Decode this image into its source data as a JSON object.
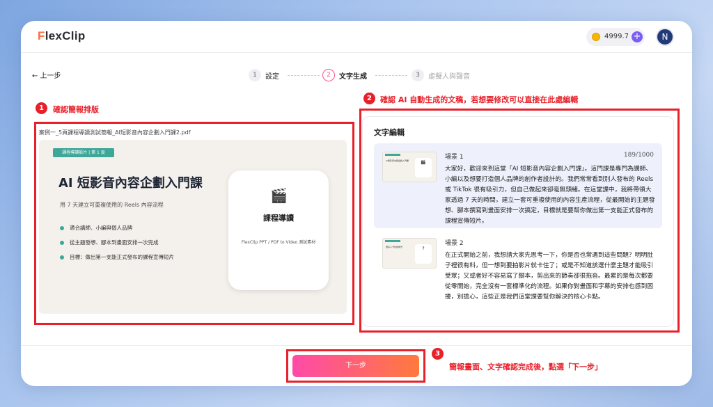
{
  "app": {
    "logo_prefix": "F",
    "logo_rest": "lexClip",
    "credits": "4999.7",
    "plus": "+",
    "avatar": "N"
  },
  "nav": {
    "back": "← 上一步"
  },
  "steps": [
    {
      "num": "1",
      "label": "設定"
    },
    {
      "num": "2",
      "label": "文字生成"
    },
    {
      "num": "3",
      "label": "虛擬人與聲音"
    }
  ],
  "annotations": {
    "a1": {
      "num": "1",
      "text": "確認簡報排版"
    },
    "a2": {
      "num": "2",
      "text": "確認 AI 自動生成的文稿，若想要修改可以直接在此處編輯"
    },
    "a3": {
      "num": "3",
      "text": "簡報畫面、文字確認完成後，點選「下一步」"
    }
  },
  "preview": {
    "filename": "案例一_5頁課程導讀測試簡報_AI短影音內容企劃入門課2.pdf",
    "tag": "課程導讀影片 | 第 1 頁",
    "title": "AI 短影音內容企劃入門課",
    "subtitle": "用 7 天建立可重複使用的 Reels 內容流程",
    "bullets": [
      "適合講師、小編與個人品牌",
      "從主題發想、腳本到畫面安排一次完成",
      "目標：做出第一支能正式發布的課程宣傳短片"
    ],
    "card_icon": "🎬",
    "card_title": "課程導讀",
    "card_footer": "FlexClip PPT / PDF to Video 測試素材"
  },
  "editor": {
    "title": "文字編輯",
    "scenes": [
      {
        "name": "場景 1",
        "count": "189/1000",
        "thumb_label": "AI短影音內容企劃入門課",
        "text": "大家好，歡迎來到這堂「AI 短影音內容企劃入門課」。這門課是專門為講師、小編以及想要打造個人品牌的創作者設計的。我們常常看到別人發布的 Reels 或 TikTok 很有吸引力，但自己做起來卻毫無頭緒。在這堂課中，我將帶領大家透過 7 天的時間，建立一套可重複使用的內容生產流程，從最開始的主題發想、腳本撰寫到畫面安排一次搞定，目標就是要幫你做出第一支能正式發布的課程宣傳短片。"
      },
      {
        "name": "場景 2",
        "count": "",
        "thumb_label": "很多人卡住的地方",
        "text": "在正式開始之前，我想請大家先思考一下，你是否也常遇到這些問題？明明肚子裡很有料，但一想到要拍影片就卡住了；或是不知道該選什麼主題才能吸引受眾；又或者好不容易寫了腳本，剪出來的節奏卻很拖沓。最累的是每次都要從零開始，完全沒有一套標準化的流程。如果你對畫面和字幕的安排也感到困擾，別擔心，這些正是我們這堂課要幫你解決的核心卡點。"
      }
    ]
  },
  "footer": {
    "next": "下一步"
  }
}
